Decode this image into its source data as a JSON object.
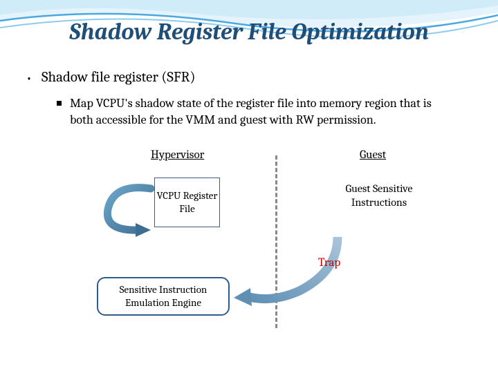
{
  "title": "Shadow Register File Optimization",
  "bullet1": "Shadow file register (SFR)",
  "sub1": "Map VCPU's shadow state of the register file into memory region that is both accessible for the VMM and guest with RW permission.",
  "diagram": {
    "hypervisor_label": "Hypervisor",
    "guest_label": "Guest",
    "vcpu_box": "VCPU Register File",
    "guest_instructions": "Guest Sensitive Instructions",
    "engine_box": "Sensitive Instruction Emulation Engine",
    "trap_label": "Trap"
  }
}
